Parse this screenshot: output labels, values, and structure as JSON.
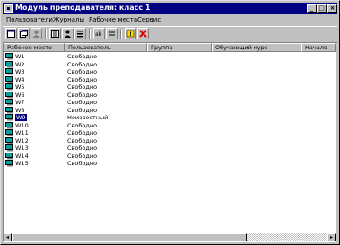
{
  "window": {
    "title": "Модуль преподавателя: класс 1",
    "controls": {
      "minimize": "_",
      "maximize": "□",
      "close": "×"
    }
  },
  "menu": [
    "Пользователи",
    "Журналы",
    "Рабочие места",
    "Сервис"
  ],
  "toolbar": {
    "icons": [
      "window-icon",
      "windows-icon",
      "users-icon",
      "list-icon",
      "user-view-icon",
      "lines-icon",
      "message-icon",
      "warning-icon",
      "delete-icon"
    ]
  },
  "table": {
    "columns": [
      "Рабочее место",
      "Пользователь",
      "Группа",
      "Обучающий курс",
      "Начало"
    ],
    "rows": [
      {
        "workstation": "W1",
        "user": "Свободно",
        "selected": false
      },
      {
        "workstation": "W2",
        "user": "Свободно",
        "selected": false
      },
      {
        "workstation": "W3",
        "user": "Свободно",
        "selected": false
      },
      {
        "workstation": "W4",
        "user": "Свободно",
        "selected": false
      },
      {
        "workstation": "W5",
        "user": "Свободно",
        "selected": false
      },
      {
        "workstation": "W6",
        "user": "Свободно",
        "selected": false
      },
      {
        "workstation": "W7",
        "user": "Свободно",
        "selected": false
      },
      {
        "workstation": "W8",
        "user": "Свободно",
        "selected": false
      },
      {
        "workstation": "W9",
        "user": "Неизвестный",
        "selected": true
      },
      {
        "workstation": "W10",
        "user": "Свободно",
        "selected": false
      },
      {
        "workstation": "W11",
        "user": "Свободно",
        "selected": false
      },
      {
        "workstation": "W12",
        "user": "Свободно",
        "selected": false
      },
      {
        "workstation": "W13",
        "user": "Свободно",
        "selected": false
      },
      {
        "workstation": "W14",
        "user": "Свободно",
        "selected": false
      },
      {
        "workstation": "W15",
        "user": "Свободно",
        "selected": false
      }
    ]
  },
  "colors": {
    "titlebar": "#000080",
    "selection": "#000080",
    "face": "#c0c0c0",
    "warning": "#ffd800",
    "delete": "#e00000"
  }
}
